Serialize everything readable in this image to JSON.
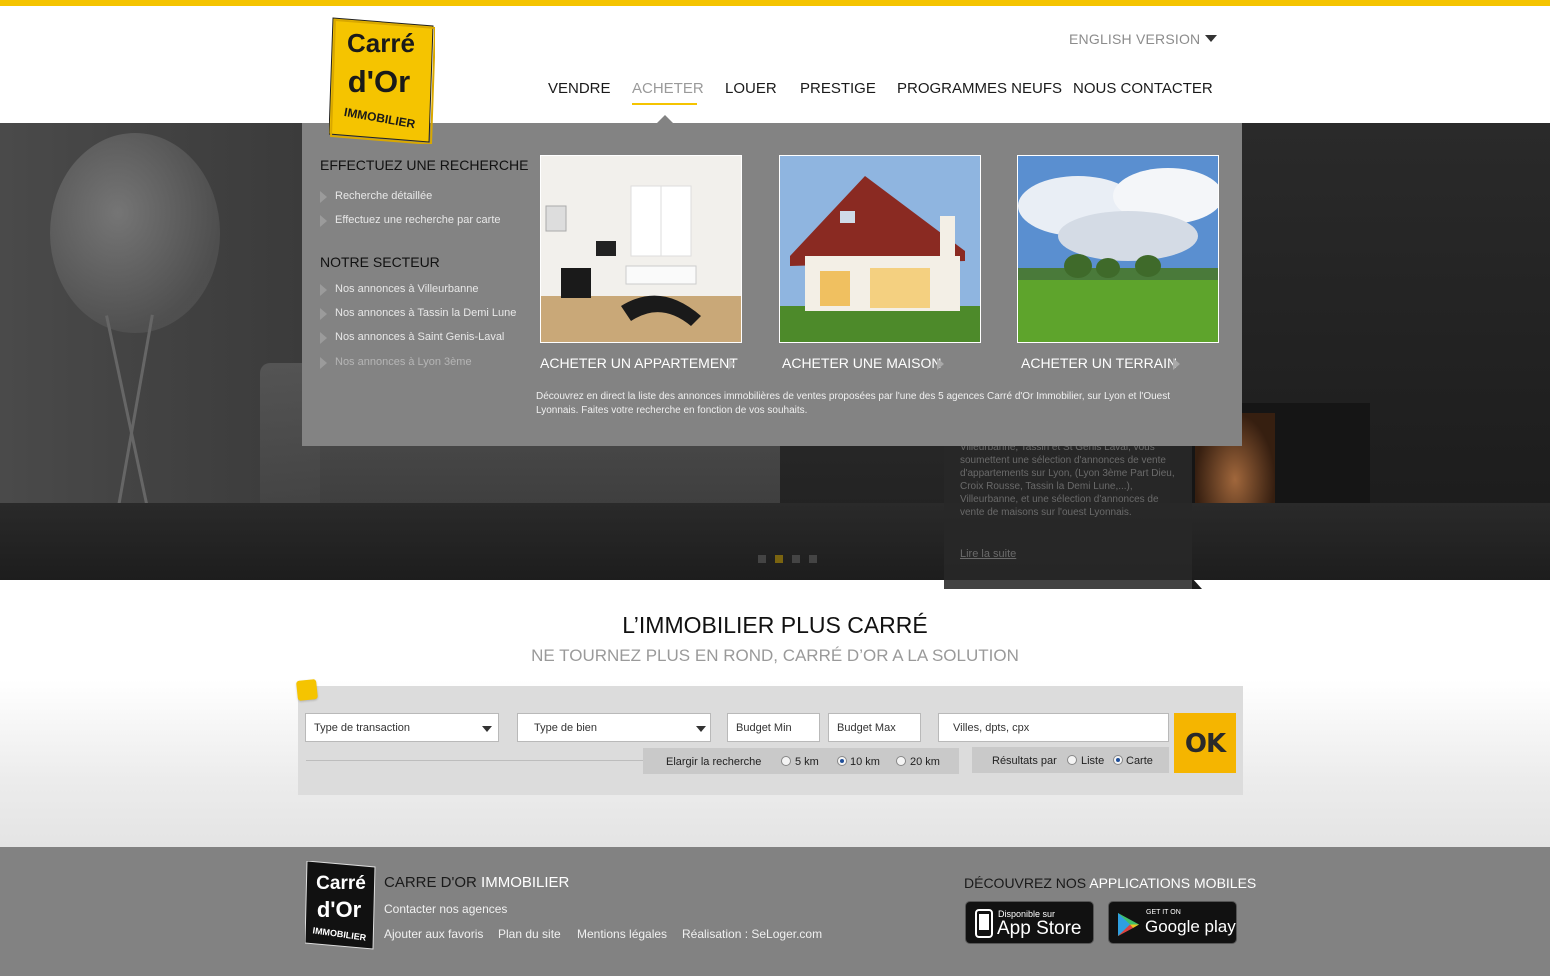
{
  "brand": {
    "logo_line1": "Carré",
    "logo_line2": "d'Or",
    "logo_line3": "IMMOBILIER",
    "accent_color": "#f5c400"
  },
  "header": {
    "language": "ENGLISH VERSION",
    "nav": [
      "VENDRE",
      "ACHETER",
      "LOUER",
      "PRESTIGE",
      "PROGRAMMES NEUFS",
      "NOUS CONTACTER"
    ],
    "active_nav": "ACHETER"
  },
  "mega_menu": {
    "search_heading": "EFFECTUEZ UNE RECHERCHE",
    "search_links": [
      "Recherche détaillée",
      "Effectuez une recherche par carte"
    ],
    "sector_heading": "NOTRE SECTEUR",
    "sector_links": [
      "Nos annonces à Villeurbanne",
      "Nos annonces à Tassin la Demi Lune",
      "Nos annonces à  Saint Genis-Laval",
      "Nos annonces à Lyon 3ème"
    ],
    "cards": [
      "ACHETER UN APPARTEMENT",
      "ACHETER UNE MAISON",
      "ACHETER UN TERRAIN"
    ],
    "description": "Découvrez en direct la liste des annonces immobilières de ventes proposées par l'une des 5 agences Carré d'Or Immobilier, sur Lyon et l'Ouest Lyonnais. Faites votre recherche en fonction de vos souhaits."
  },
  "hero": {
    "text": "Villeurbanne, Tassin et St Genis Laval, vous soumettent une sélection d'annonces de vente d'appartements sur Lyon, (Lyon 3ème Part Dieu, Croix Rousse, Tassin la Demi Lune,...), Villeurbanne, et une sélection d'annonces de vente de maisons sur l'ouest Lyonnais.",
    "read_more": "Lire la suite",
    "slide_count": 4,
    "active_slide": 2
  },
  "tagline": {
    "title": "L’IMMOBILIER PLUS CARRÉ",
    "subtitle": "NE TOURNEZ PLUS EN ROND, CARRÉ D’OR A LA SOLUTION"
  },
  "search": {
    "transaction_placeholder": "Type de transaction",
    "property_placeholder": "Type de bien",
    "budget_min": "Budget Min",
    "budget_max": "Budget Max",
    "location_placeholder": "Villes, dpts, cpx",
    "widen_label": "Elargir la recherche",
    "radius_options": [
      "5 km",
      "10 km",
      "20 km"
    ],
    "radius_selected": "10 km",
    "results_label": "Résultats par",
    "results_options": [
      "Liste",
      "Carte"
    ],
    "results_selected": "Carte",
    "submit": "OK"
  },
  "footer": {
    "title_part1": "CARRE D'OR",
    "title_part2": "IMMOBILIER",
    "contact_link": "Contacter nos agences",
    "links": [
      "Ajouter aux favoris",
      "Plan du site",
      "Mentions légales",
      "Réalisation : SeLoger.com"
    ],
    "apps_part1": "DÉCOUVREZ NOS",
    "apps_part2": "APPLICATIONS MOBILES",
    "appstore_small": "Disponible sur",
    "appstore_big": "App Store",
    "googleplay_small": "GET IT ON",
    "googleplay_big": "Google play"
  }
}
